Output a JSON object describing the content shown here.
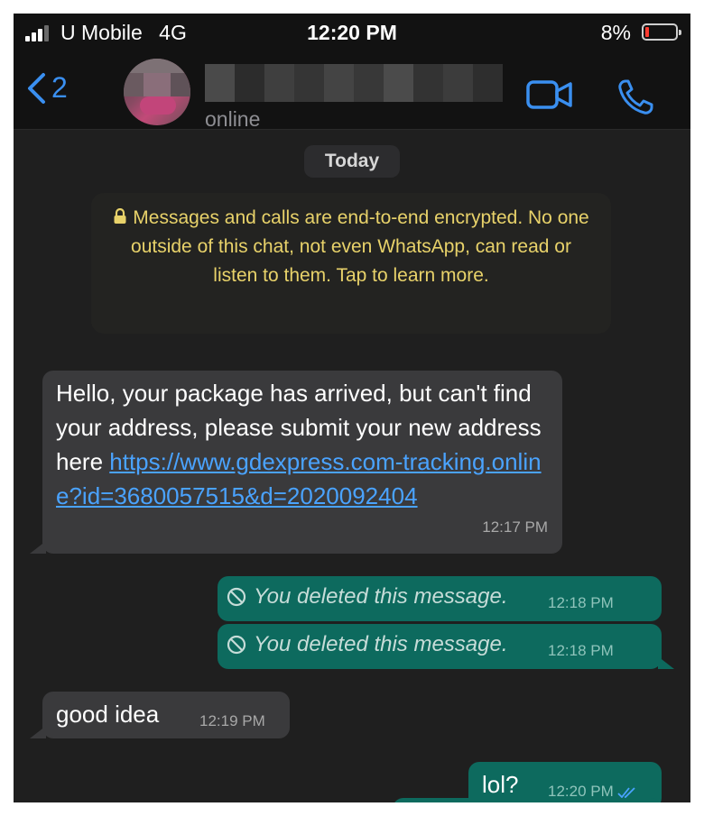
{
  "status_bar": {
    "carrier": "U Mobile",
    "network": "4G",
    "time": "12:20 PM",
    "battery_percent": "8%",
    "battery_level": 0.08
  },
  "header": {
    "back_count": "2",
    "presence": "online",
    "icons": [
      "chevron-left-icon",
      "video-call-icon",
      "phone-icon"
    ],
    "accent_color": "#3a8ff0"
  },
  "chat": {
    "date_label": "Today",
    "encryption_notice": "Messages and calls are end-to-end encrypted. No one outside of this chat, not even WhatsApp, can read or listen to them. Tap to learn more.",
    "messages": [
      {
        "direction": "incoming",
        "text": "Hello, your package has arrived, but can't find your address, please submit your new address here ",
        "link": "https://www.gdexpress.com-tracking.online?id=3680057515&d=2020092404",
        "time": "12:17 PM"
      },
      {
        "direction": "outgoing",
        "text": "You deleted this message.",
        "time": "12:18 PM"
      },
      {
        "direction": "outgoing",
        "text": "You deleted this message.",
        "time": "12:18 PM"
      },
      {
        "direction": "incoming",
        "text": "good idea",
        "time": "12:19 PM"
      },
      {
        "direction": "outgoing",
        "text": "lol?",
        "time": "12:20 PM",
        "status": "read"
      }
    ]
  },
  "colors": {
    "incoming_bubble": "#3a3a3c",
    "outgoing_bubble": "#0d6a5e",
    "notice_text": "#e8d26a",
    "link": "#4aa3ff"
  }
}
